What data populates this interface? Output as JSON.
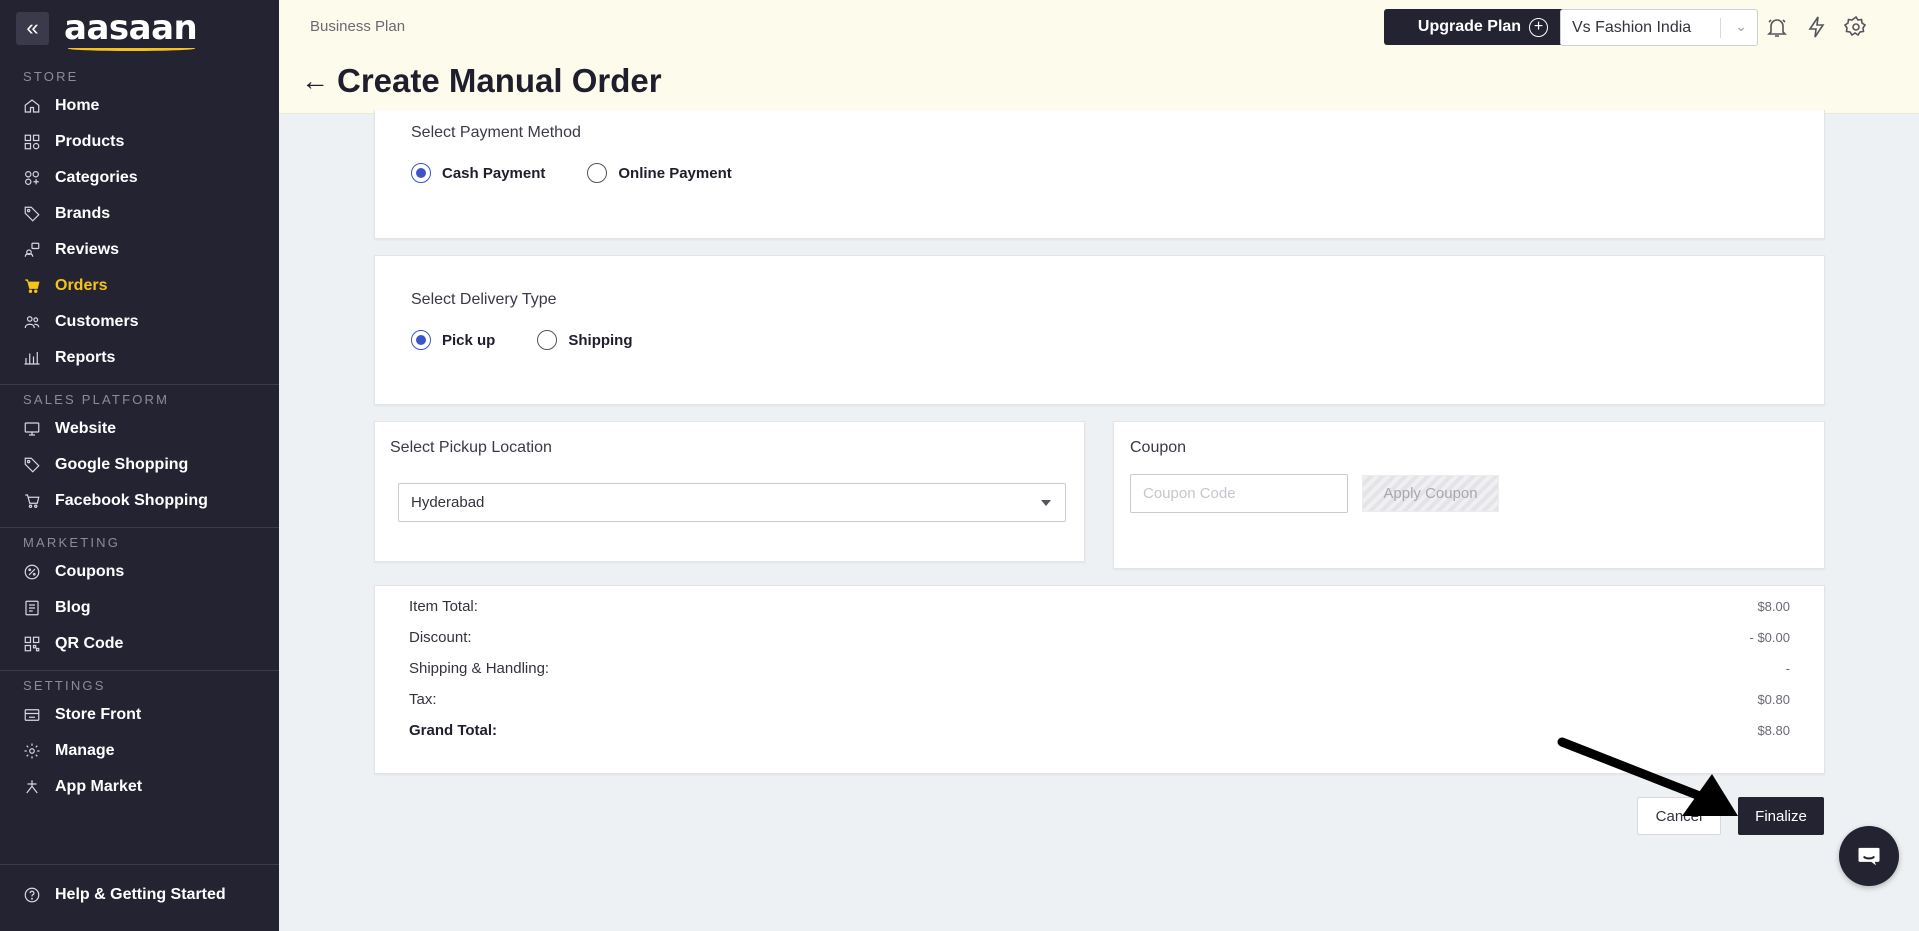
{
  "sidebar": {
    "logo": "aasaan",
    "sections": {
      "store": "STORE",
      "sales_platform": "SALES PLATFORM",
      "marketing": "MARKETING",
      "settings": "SETTINGS"
    },
    "store_items": [
      "Home",
      "Products",
      "Categories",
      "Brands",
      "Reviews",
      "Orders",
      "Customers",
      "Reports"
    ],
    "sales_items": [
      "Website",
      "Google Shopping",
      "Facebook Shopping"
    ],
    "marketing_items": [
      "Coupons",
      "Blog",
      "QR Code"
    ],
    "settings_items": [
      "Store Front",
      "Manage",
      "App Market"
    ],
    "help": "Help & Getting Started",
    "active_item": "Orders",
    "active_color": "#f6c31a"
  },
  "header": {
    "plan": "Business Plan",
    "title": "Create Manual Order",
    "upgrade_label": "Upgrade Plan",
    "store_name": "Vs Fashion India"
  },
  "payment": {
    "label": "Select Payment Method",
    "options": [
      "Cash Payment",
      "Online Payment"
    ],
    "selected": "Cash Payment"
  },
  "delivery": {
    "label": "Select Delivery Type",
    "options": [
      "Pick up",
      "Shipping"
    ],
    "selected": "Pick up"
  },
  "pickup": {
    "label": "Select Pickup Location",
    "value": "Hyderabad"
  },
  "coupon": {
    "label": "Coupon",
    "placeholder": "Coupon Code",
    "apply_label": "Apply Coupon"
  },
  "summary": {
    "item_total_label": "Item Total:",
    "item_total": "$8.00",
    "discount_label": "Discount:",
    "discount": "- $0.00",
    "shipping_label": "Shipping & Handling:",
    "shipping": "-",
    "tax_label": "Tax:",
    "tax": "$0.80",
    "grand_total_label": "Grand Total:",
    "grand_total": "$8.80"
  },
  "actions": {
    "cancel_label": "Cancel",
    "finalize_label": "Finalize"
  }
}
